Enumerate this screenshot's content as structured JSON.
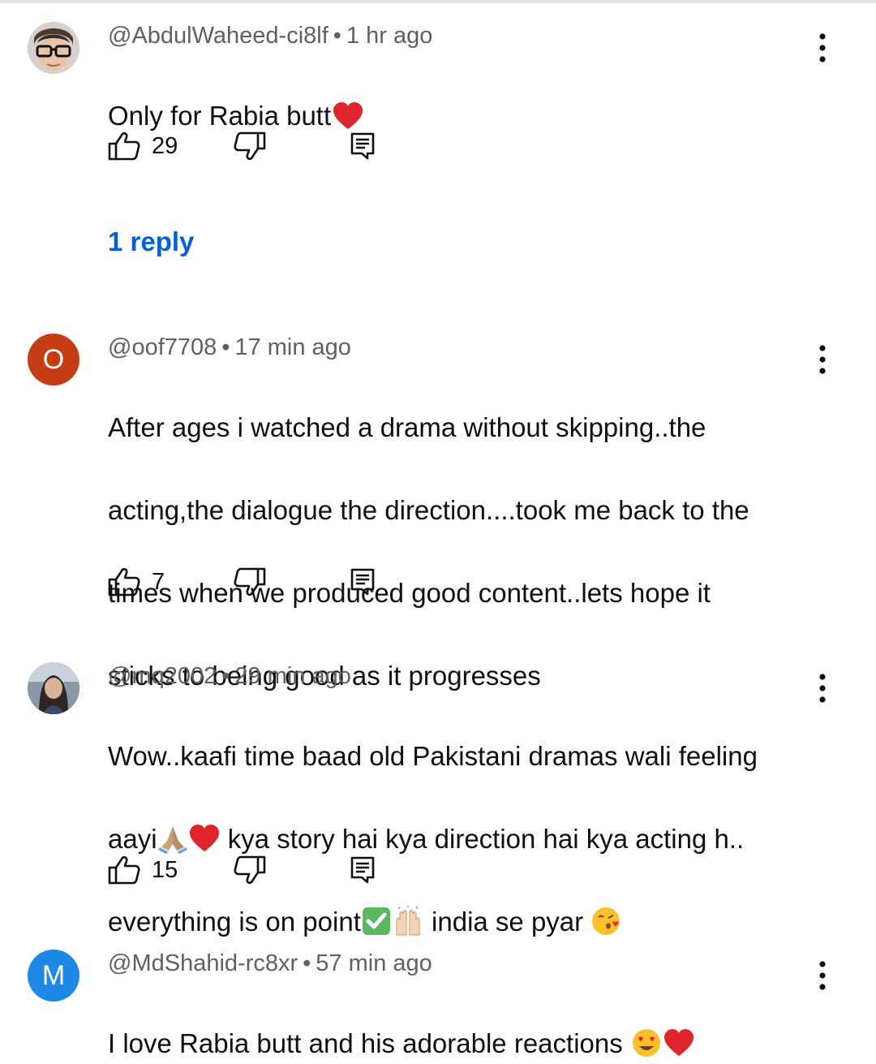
{
  "comments": [
    {
      "handle": "@AbdulWaheed-ci8lf",
      "time": "1 hr ago",
      "text": "Only for Rabia butt",
      "likes": "29",
      "replies_link": "1 reply",
      "avatar": {
        "type": "photo",
        "color": "#cfc6c2"
      }
    },
    {
      "handle": "@oof7708",
      "time": "17 min ago",
      "lines": [
        "After ages i watched a drama without skipping..the",
        "acting,the dialogue the direction....took me back to the",
        "times when we produced good content..lets hope it",
        "sticks to being good as it progresses"
      ],
      "likes": "7",
      "avatar": {
        "type": "letter",
        "letter": "O",
        "color": "#c43d14"
      }
    },
    {
      "handle": "@mq2002",
      "time": "29 min ago",
      "line1": "Wow..kaafi time baad old Pakistani dramas wali feeling",
      "line2a": "aayi",
      "line2b": " kya story hai kya direction hai kya acting h..",
      "line3a": "everything is on point",
      "line3b": " india se pyar ",
      "likes": "15",
      "avatar": {
        "type": "photo",
        "color": "#7a8a9a"
      }
    },
    {
      "handle": "@MdShahid-rc8xr",
      "time": "57 min ago",
      "text": "I love Rabia butt and his adorable reactions ",
      "avatar": {
        "type": "letter",
        "letter": "M",
        "color": "#1e88e5"
      }
    }
  ],
  "separator": "•",
  "icons": [
    "like-icon",
    "dislike-icon",
    "reply-icon",
    "more-vert-icon",
    "heart-emoji",
    "praying-hands-emoji",
    "check-mark-emoji",
    "raising-hands-emoji",
    "kissing-face-emoji",
    "heart-eyes-emoji"
  ],
  "colors": {
    "link": "#065fd4",
    "meta": "#606060",
    "text": "#0f0f0f"
  }
}
